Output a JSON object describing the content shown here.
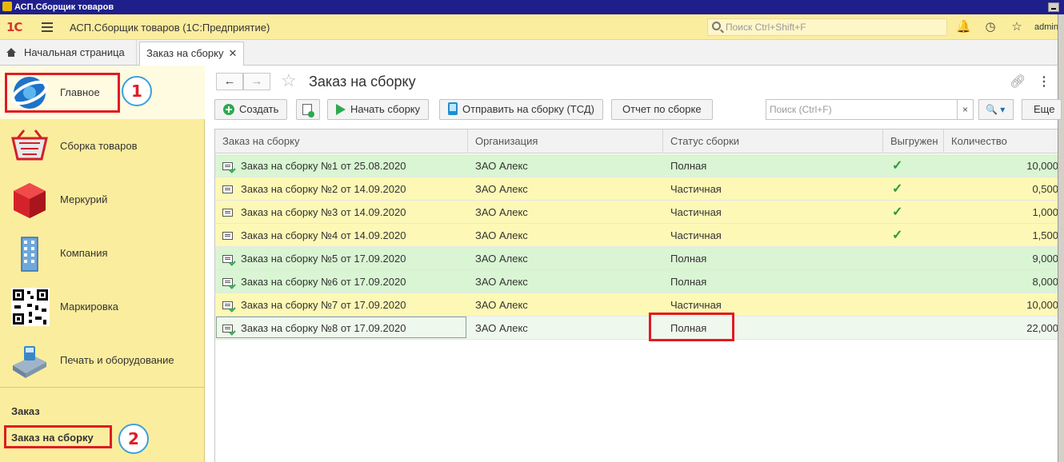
{
  "window": {
    "title": "АСП.Сборщик товаров"
  },
  "header": {
    "logo": "1С",
    "app_title": "АСП.Сборщик товаров  (1С:Предприятие)",
    "search_placeholder": "Поиск Ctrl+Shift+F",
    "user": "admin",
    "icons": [
      "menu-icon",
      "bell-icon",
      "history-icon",
      "star-icon"
    ]
  },
  "tabs": {
    "home_label": "Начальная страница",
    "active_label": "Заказ на сборку",
    "close_glyph": "✕"
  },
  "sidebar": {
    "items": [
      {
        "label": "Главное",
        "icon": "globe-icon"
      },
      {
        "label": "Сборка товаров",
        "icon": "basket-icon"
      },
      {
        "label": "Меркурий",
        "icon": "cube-icon"
      },
      {
        "label": "Компания",
        "icon": "building-icon"
      },
      {
        "label": "Маркировка",
        "icon": "qr-code-icon"
      },
      {
        "label": "Печать и оборудование",
        "icon": "payment-terminal-icon"
      }
    ],
    "section_title": "Заказ",
    "section_link": "Заказ на сборку"
  },
  "annotations": {
    "badge_1": "1",
    "badge_2": "2"
  },
  "form": {
    "title": "Заказ на сборку",
    "buttons": {
      "create": "Создать",
      "start": "Начать сборку",
      "send": "Отправить на сборку (ТСД)",
      "report": "Отчет по сборке",
      "more": "Еще"
    },
    "search_placeholder": "Поиск (Ctrl+F)",
    "search_clear": "×",
    "search_go": "🔍 ▾"
  },
  "table": {
    "columns": [
      "Заказ на сборку",
      "Организация",
      "Статус сборки",
      "Выгружен",
      "Количество"
    ],
    "rows": [
      {
        "doc": "Заказ на сборку №1 от 25.08.2020",
        "org": "ЗАО Алекс",
        "status": "Полная",
        "uploaded": "✓",
        "qty": "10,000",
        "color": "green"
      },
      {
        "doc": "Заказ на сборку №2 от 14.09.2020",
        "org": "ЗАО Алекс",
        "status": "Частичная",
        "uploaded": "✓",
        "qty": "0,500",
        "color": "yellow"
      },
      {
        "doc": "Заказ на сборку №3 от 14.09.2020",
        "org": "ЗАО Алекс",
        "status": "Частичная",
        "uploaded": "✓",
        "qty": "1,000",
        "color": "yellow"
      },
      {
        "doc": "Заказ на сборку №4 от 14.09.2020",
        "org": "ЗАО Алекс",
        "status": "Частичная",
        "uploaded": "✓",
        "qty": "1,500",
        "color": "yellow"
      },
      {
        "doc": "Заказ на сборку №5 от 17.09.2020",
        "org": "ЗАО Алекс",
        "status": "Полная",
        "uploaded": "",
        "qty": "9,000",
        "color": "green"
      },
      {
        "doc": "Заказ на сборку №6 от 17.09.2020",
        "org": "ЗАО Алекс",
        "status": "Полная",
        "uploaded": "",
        "qty": "8,000",
        "color": "green"
      },
      {
        "doc": "Заказ на сборку №7 от 17.09.2020",
        "org": "ЗАО Алекс",
        "status": "Частичная",
        "uploaded": "",
        "qty": "10,000",
        "color": "yellow"
      },
      {
        "doc": "Заказ на сборку №8 от 17.09.2020",
        "org": "ЗАО Алекс",
        "status": "Полная",
        "uploaded": "",
        "qty": "22,000",
        "color": "selected"
      }
    ]
  },
  "colors": {
    "header_bg": "#fbed9e",
    "sidebar_bg": "#fbed9e",
    "row_full": "#d9f5d3",
    "row_partial": "#fdf8b6",
    "highlight": "#e01b24",
    "badge_ring": "#3aa0e0"
  }
}
